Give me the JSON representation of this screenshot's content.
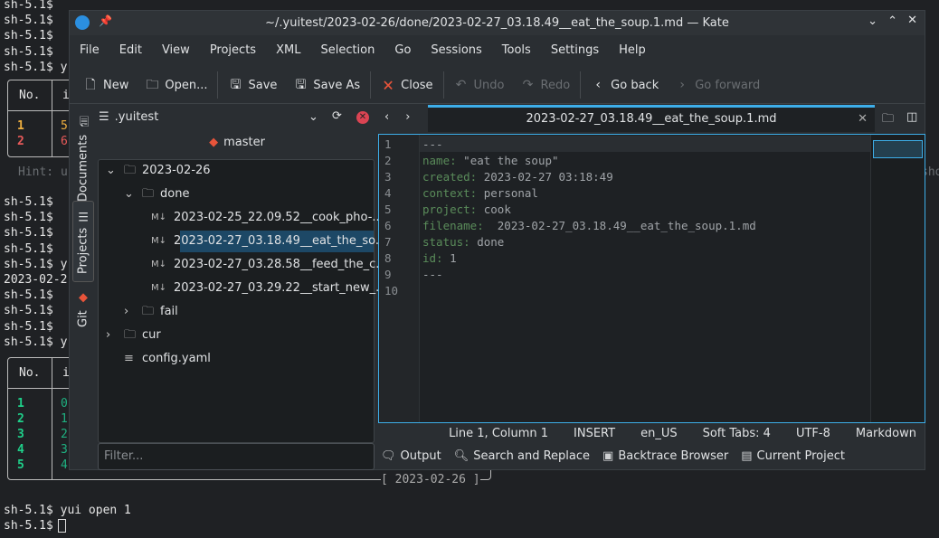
{
  "terminal": {
    "prompt": "sh-5.1$",
    "lines_top": [
      "sh-5.1$",
      "sh-5.1$",
      "sh-5.1$",
      "sh-5.1$",
      "sh-5.1$ y"
    ],
    "table1": {
      "header": [
        "No.",
        "i"
      ],
      "rows": [
        [
          "1",
          "5"
        ],
        [
          "2",
          "6"
        ]
      ]
    },
    "hint": "Hint: u",
    "hint_tail": "sho",
    "lines_mid": [
      "sh-5.1$",
      "sh-5.1$",
      "sh-5.1$",
      "sh-5.1$",
      "sh-5.1$ y",
      "2023-02-2",
      "sh-5.1$",
      "sh-5.1$",
      "sh-5.1$",
      "sh-5.1$ y"
    ],
    "table2": {
      "header": [
        "No.",
        "i"
      ],
      "rows": [
        [
          "1",
          "0"
        ],
        [
          "2",
          "1"
        ],
        [
          "3",
          "2"
        ],
        [
          "4",
          "3"
        ],
        [
          "5",
          "4"
        ]
      ],
      "footer": "[ 2023-02-26 ]"
    },
    "cmd": "sh-5.1$ yui open 1",
    "last": "sh-5.1$ "
  },
  "window": {
    "title": "~/.yuitest/2023-02-26/done/2023-02-27_03.18.49__eat_the_soup.1.md — Kate"
  },
  "menu": [
    "File",
    "Edit",
    "View",
    "Projects",
    "XML",
    "Selection",
    "Go",
    "Sessions",
    "Tools",
    "Settings",
    "Help"
  ],
  "toolbar": {
    "new": "New",
    "open": "Open...",
    "save": "Save",
    "save_as": "Save As",
    "close": "Close",
    "undo": "Undo",
    "redo": "Redo",
    "go_back": "Go back",
    "go_forward": "Go forward"
  },
  "side_tabs": {
    "documents": "Documents",
    "projects": "Projects",
    "git": "Git"
  },
  "project": {
    "name": ".yuitest",
    "branch": "master",
    "filter_placeholder": "Filter...",
    "tree": [
      {
        "label": "2023-02-26",
        "type": "folder",
        "depth": 0,
        "expanded": true
      },
      {
        "label": "done",
        "type": "folder",
        "depth": 1,
        "expanded": true
      },
      {
        "label": "2023-02-25_22.09.52__cook_pho-...",
        "type": "md",
        "depth": 2
      },
      {
        "label": "2023-02-27_03.18.49__eat_the_so...",
        "type": "md",
        "depth": 2,
        "selected": true
      },
      {
        "label": "2023-02-27_03.28.58__feed_the_c...",
        "type": "md",
        "depth": 2
      },
      {
        "label": "2023-02-27_03.29.22__start_new_...",
        "type": "md",
        "depth": 2
      },
      {
        "label": "fail",
        "type": "folder",
        "depth": 1,
        "expanded": false
      },
      {
        "label": "cur",
        "type": "folder",
        "depth": 0,
        "expanded": false
      },
      {
        "label": "config.yaml",
        "type": "file",
        "depth": 0
      }
    ]
  },
  "tab": {
    "label": "2023-02-27_03.18.49__eat_the_soup.1.md"
  },
  "editor": {
    "lines": [
      {
        "k": "---",
        "v": ""
      },
      {
        "k": "name:",
        "v": " \"eat the soup\""
      },
      {
        "k": "created:",
        "v": " 2023-02-27 03:18:49"
      },
      {
        "k": "context:",
        "v": " personal"
      },
      {
        "k": "project:",
        "v": " cook"
      },
      {
        "k": "filename:",
        "v": "  2023-02-27_03.18.49__eat_the_soup.1.md"
      },
      {
        "k": "status:",
        "v": " done"
      },
      {
        "k": "id:",
        "v": " 1"
      },
      {
        "k": "---",
        "v": ""
      },
      {
        "k": "",
        "v": ""
      }
    ]
  },
  "status": {
    "position": "Line 1, Column 1",
    "mode": "INSERT",
    "lang": "en_US",
    "tabs": "Soft Tabs: 4",
    "encoding": "UTF-8",
    "syntax": "Markdown"
  },
  "bottom": {
    "output": "Output",
    "search": "Search and Replace",
    "backtrace": "Backtrace Browser",
    "current_project": "Current Project"
  },
  "colors": {
    "accent": "#3daee9",
    "key": "#5a8c5a",
    "selection": "#1d4866",
    "git": "#e8543a"
  }
}
